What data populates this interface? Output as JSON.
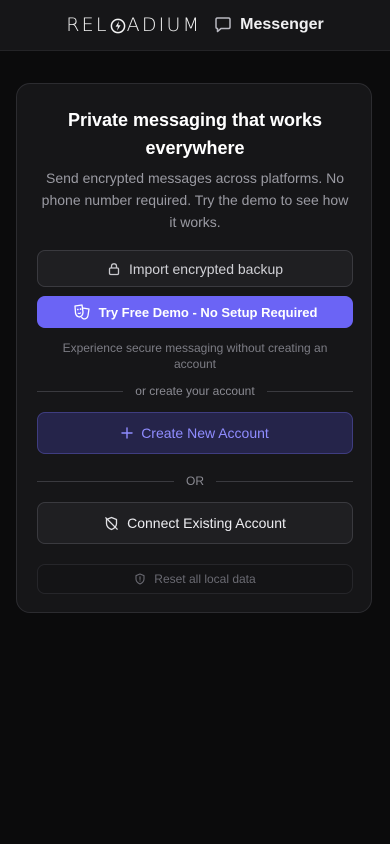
{
  "header": {
    "logo_prefix": "REL",
    "logo_suffix": "ADIUM",
    "app_name": "Messenger",
    "icons": {
      "chat": "chat-bubble-icon"
    }
  },
  "card": {
    "title": "Private messaging that works everywhere",
    "subtitle": "Send encrypted messages across platforms. No phone number required. Try the demo to see how it works.",
    "import_button": "Import encrypted backup",
    "demo_button": "Try Free Demo - No Setup Required",
    "demo_note": "Experience secure messaging without creating an account",
    "divider_create": "or create your account",
    "create_button": "Create New Account",
    "divider_or": "OR",
    "connect_button": "Connect Existing Account",
    "reset_button": "Reset all local data"
  },
  "colors": {
    "background": "#0b0b0c",
    "card": "#161618",
    "accent": "#6b64f5",
    "create_text": "#8f8cff"
  }
}
